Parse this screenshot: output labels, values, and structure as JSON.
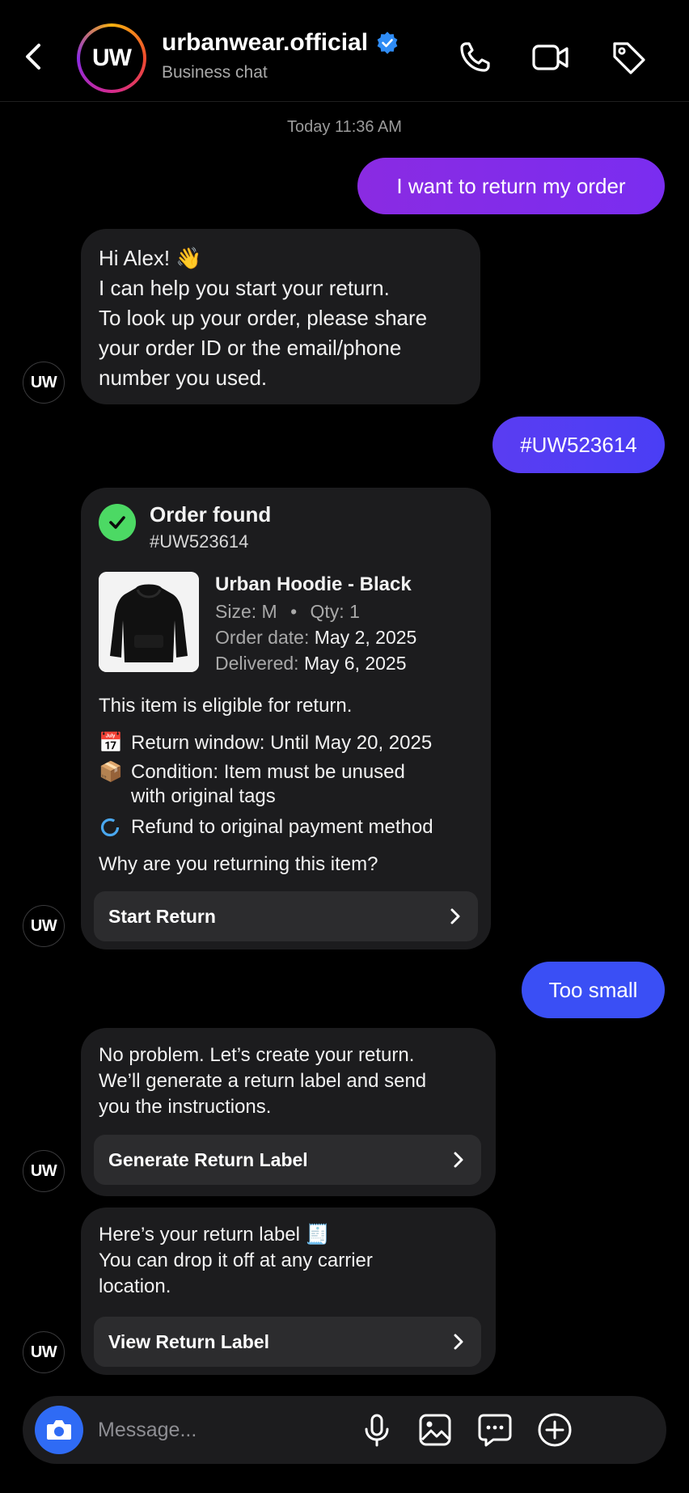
{
  "header": {
    "avatar_initials": "UW",
    "title": "urbanwear.official",
    "subtitle": "Business chat",
    "icons": [
      "back-chevron-icon",
      "verified-badge-icon",
      "phone-icon",
      "video-icon",
      "tag-icon"
    ]
  },
  "timestamp": "Today 11:36 AM",
  "messages": {
    "out1": "I want to return my order",
    "in1": {
      "lines": [
        "Hi Alex! 👋",
        "I can help you start your return.",
        "To look up your order, please share",
        "your order ID or the email/phone",
        "number you used."
      ]
    },
    "out2": "#UW523614",
    "order_card": {
      "title": "Order found",
      "order_id": "#UW523614",
      "product_name": "Urban Hoodie - Black",
      "size_label": "Size: M",
      "bullet": "•",
      "qty_label": "Qty: 1",
      "order_date_label": "Order date:",
      "order_date": "May 2, 2025",
      "delivered_label": "Delivered:",
      "delivered_date": "May 6, 2025",
      "eligible": "This item is eligible for return.",
      "return_window": "Return window: Until May 20, 2025",
      "condition_line1": "Condition: Item must be unused",
      "condition_line2": "with original tags",
      "refund": "Refund to original payment method",
      "question": "Why are you returning this item?",
      "button": "Start Return",
      "emoji_calendar": "📅",
      "emoji_box": "📦"
    },
    "out3": "Too small",
    "in2": {
      "lines": [
        "No problem. Let’s create your return.",
        "We’ll generate a return label and send",
        "you the instructions."
      ],
      "button": "Generate Return Label"
    },
    "in3": {
      "line1": "Here’s your return label",
      "emoji": "🧾",
      "lines": [
        "You can drop it off at any carrier",
        "location."
      ],
      "button": "View Return Label"
    },
    "avatar_initials": "UW"
  },
  "composer": {
    "placeholder": "Message...",
    "icons": [
      "camera-icon",
      "microphone-icon",
      "image-icon",
      "sticker-chat-icon",
      "plus-circle-icon"
    ]
  },
  "colors": {
    "out_gradient_start": "#8a2be2",
    "out_gradient_end": "#3a4ff5",
    "verified": "#2f8cf5",
    "check": "#4cd964",
    "bubble_in": "#1c1c1e"
  }
}
